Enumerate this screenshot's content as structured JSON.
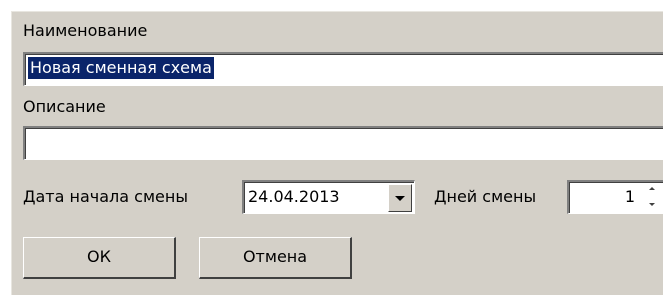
{
  "dialog": {
    "name_label": "Наименование",
    "name_value": "Новая сменная схема",
    "description_label": "Описание",
    "description_value": "",
    "shift_start_label": "Дата начала смены",
    "shift_start_value": "24.04.2013",
    "shift_days_label": "Дней смены",
    "shift_days_value": "1",
    "ok_label": "ОК",
    "cancel_label": "Отмена"
  },
  "icons": {
    "dropdown": "chevron-down-icon",
    "spin_up": "arrow-up-icon",
    "spin_down": "arrow-down-icon"
  },
  "colors": {
    "window_background": "#d4d0c8",
    "selection_background": "#0a246a",
    "selection_text": "#ffffff",
    "field_background": "#ffffff"
  }
}
